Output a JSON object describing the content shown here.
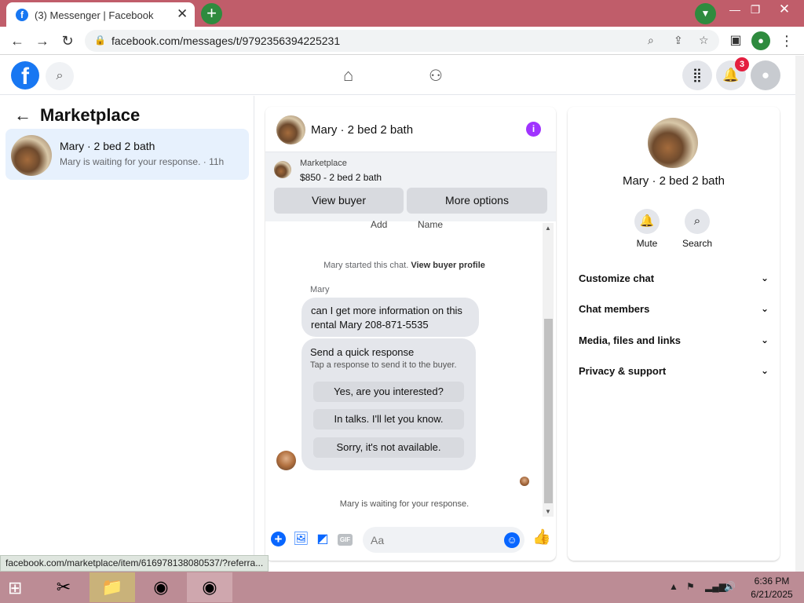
{
  "browser": {
    "tab_title": "(3) Messenger | Facebook",
    "url": "facebook.com/messages/t/9792356394225231",
    "status_url": "facebook.com/marketplace/item/616978138080537/?referra..."
  },
  "header": {
    "notification_count": "3"
  },
  "left_pane": {
    "title": "Marketplace",
    "conversation": {
      "name": "Mary · 2 bed 2 bath",
      "subtitle": "Mary is waiting for your response. · 11h"
    }
  },
  "chat": {
    "title": "Mary · 2 bed 2 bath",
    "listing": {
      "label": "Marketplace",
      "price_title": "$850 - 2 bed 2 bath",
      "view_buyer": "View buyer",
      "more_options": "More options"
    },
    "truncated": {
      "add": "Add",
      "name": "Name"
    },
    "started_text": "Mary started this chat. ",
    "view_buyer_profile": "View buyer profile",
    "sender": "Mary",
    "message": "can I get more information on this rental  Mary  208-871-5535",
    "quick_response": {
      "title": "Send a quick response",
      "subtitle": "Tap a response to send it to the buyer.",
      "options": [
        "Yes, are you interested?",
        "In talks. I'll let you know.",
        "Sorry, it's not available."
      ]
    },
    "waiting": "Mary is waiting for your response.",
    "composer_placeholder": "Aa",
    "gif_label": "GIF"
  },
  "right_panel": {
    "name": "Mary · 2 bed 2 bath",
    "mute": "Mute",
    "search": "Search",
    "sections": [
      "Customize chat",
      "Chat members",
      "Media, files and links",
      "Privacy & support"
    ]
  },
  "taskbar": {
    "time": "6:36 PM",
    "date": "6/21/2025"
  },
  "colors": {
    "facebook_blue": "#1877f2",
    "messenger_blue": "#0866ff",
    "titlebar": "#c05d6a",
    "taskbar": "#bc8c95",
    "info_purple": "#a033ff",
    "badge_red": "#e41e3f"
  }
}
